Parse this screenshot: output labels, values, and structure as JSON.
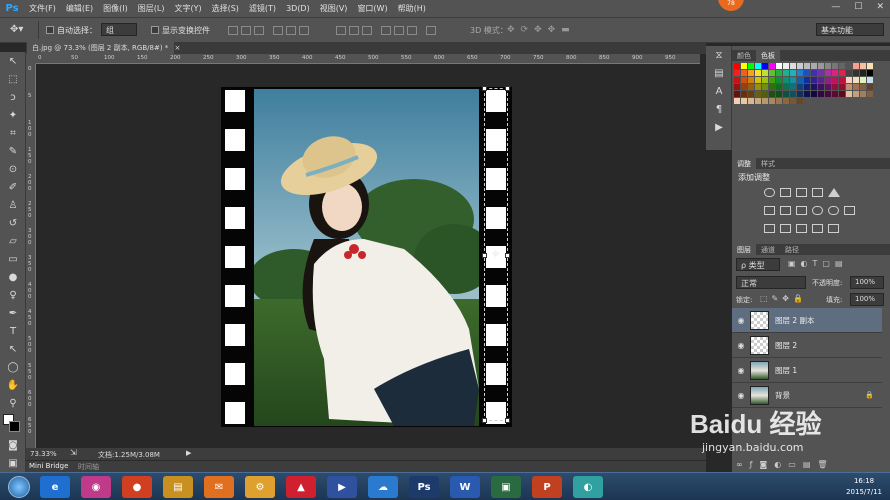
{
  "app": {
    "logo": "Ps",
    "menu": [
      "文件(F)",
      "编辑(E)",
      "图像(I)",
      "图层(L)",
      "文字(Y)",
      "选择(S)",
      "滤镜(T)",
      "3D(D)",
      "视图(V)",
      "窗口(W)",
      "帮助(H)"
    ],
    "badge": "78",
    "window_buttons": [
      "—",
      "☐",
      "✕"
    ]
  },
  "options_bar": {
    "auto_select_label": "自动选择：",
    "auto_select_value": "组",
    "show_transform_label": "显示变换控件",
    "mode_3d_label": "3D 模式：",
    "workspace": "基本功能"
  },
  "document": {
    "tab_title": "白.jpg @ 73.3% (图层 2 副本, RGB/8#) *",
    "tab_close": "×",
    "zoom": "73.33%",
    "doc_info": "文档:1.25M/3.08M"
  },
  "ruler": {
    "h_ticks": [
      "0",
      "50",
      "100",
      "150",
      "200",
      "250",
      "300",
      "350",
      "400",
      "450",
      "500",
      "550",
      "600",
      "650",
      "700",
      "750",
      "800",
      "850",
      "900",
      "950"
    ],
    "v_ticks": [
      "0",
      "5",
      "1 0 0",
      "1 5 0",
      "2 0 0",
      "2 5 0",
      "3 0 0",
      "3 5 0",
      "4 0 0",
      "4 5 0",
      "5 0 0",
      "5 5 0",
      "6 0 0",
      "6 5 0"
    ]
  },
  "bottom_tabs": [
    "Mini Bridge",
    "时间轴"
  ],
  "panels": {
    "color_tabs": [
      "颜色",
      "色板"
    ],
    "adjust_tabs": [
      "调整",
      "样式"
    ],
    "add_adjustment": "添加调整",
    "layers_tabs": [
      "图层",
      "通道",
      "路径"
    ],
    "filter_kind": "ρ 类型",
    "blend_mode": "正常",
    "opacity_label": "不透明度:",
    "opacity_value": "100%",
    "lock_label": "锁定:",
    "fill_label": "填充:",
    "fill_value": "100%",
    "layers": [
      {
        "name": "图层 2 副本",
        "thumb": "check",
        "selected": true
      },
      {
        "name": "图层 2",
        "thumb": "check",
        "selected": false
      },
      {
        "name": "图层 1",
        "thumb": "pic",
        "selected": false
      },
      {
        "name": "背景",
        "thumb": "pic",
        "selected": false
      }
    ]
  },
  "taskbar": {
    "apps": [
      "e",
      "◉",
      "●",
      "▤",
      "✉",
      "⚙",
      "▲",
      "▶",
      "☁",
      "Ps",
      "W",
      "▣",
      "P",
      "◐"
    ],
    "time": "16:18",
    "date": "2015/7/11"
  },
  "watermark": {
    "brand": "Baidu 经验",
    "url": "jingyan.baidu.com"
  },
  "colors": {
    "ui_bg": "#535353",
    "canvas_bg": "#282828",
    "selected_layer": "#5f6d80",
    "accent_badge": "#e86a1e"
  }
}
